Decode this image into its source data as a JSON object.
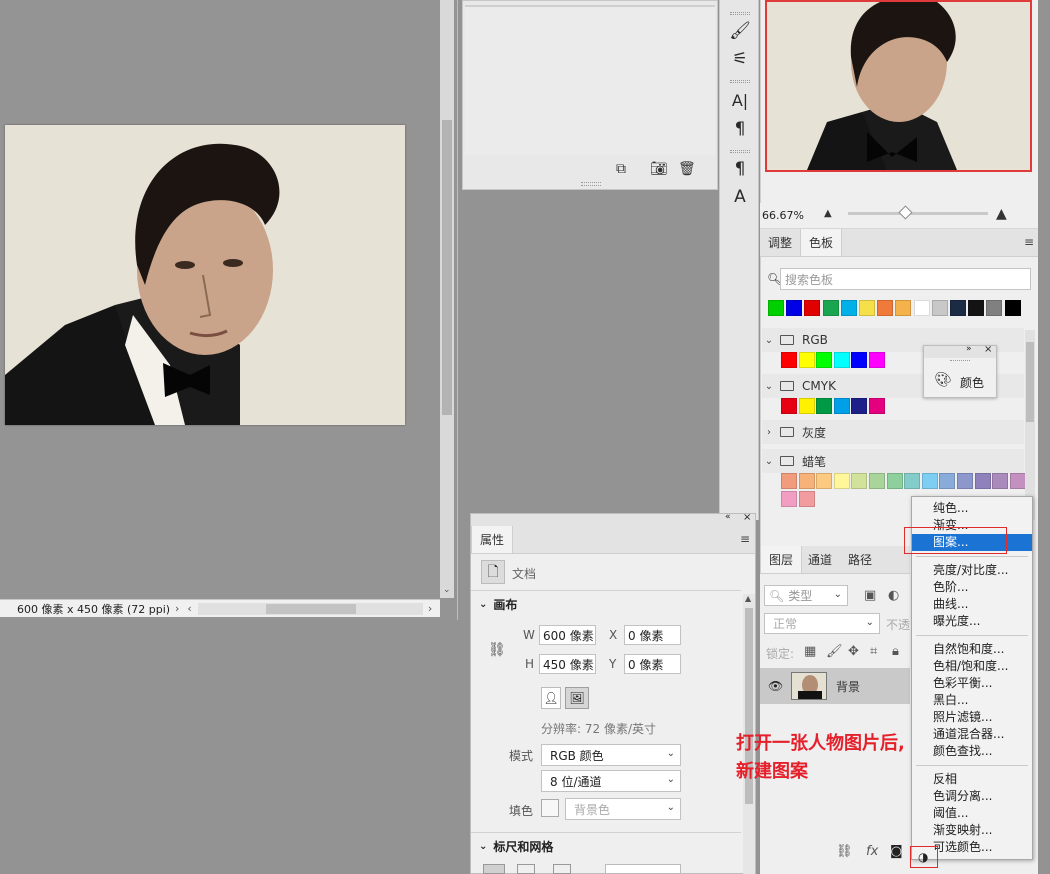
{
  "document": {
    "status_text": "600 像素 x 450 像素 (72 ppi)"
  },
  "navigator": {
    "zoom": "66.67%",
    "zoom_fraction": 0.4
  },
  "swatches_panel": {
    "tabs": [
      "调整",
      "色板"
    ],
    "active_tab": "色板",
    "search_placeholder": "搜索色板",
    "recent_colors": [
      "#00d000",
      "#0000e6",
      "#e00000",
      "#1aa650",
      "#00b0e6",
      "#f5e04a",
      "#f07a3a",
      "#f5b14a",
      "#ffffff",
      "#c8c8c8",
      "#1c2b44",
      "#141414",
      "#808080",
      "#000000"
    ],
    "groups": [
      {
        "name": "RGB",
        "expanded": true,
        "colors": [
          "#ff0000",
          "#ffff00",
          "#00ff00",
          "#00ffff",
          "#0000ff",
          "#ff00ff"
        ]
      },
      {
        "name": "CMYK",
        "expanded": true,
        "colors": [
          "#e60012",
          "#fff100",
          "#009944",
          "#00a0e9",
          "#1d2088",
          "#e4007f"
        ]
      },
      {
        "name": "灰度",
        "expanded": false,
        "colors": []
      },
      {
        "name": "蜡笔",
        "expanded": true,
        "colors": [
          "#f29c7e",
          "#f7b27a",
          "#fcc980",
          "#fff799",
          "#d1e29a",
          "#a9d49a",
          "#8ecf9e",
          "#84ccc9",
          "#7ecef4",
          "#88abda",
          "#8c97cb",
          "#8f82bc",
          "#aa89bd",
          "#c490bf",
          "#f19ec2",
          "#f29c9f"
        ]
      }
    ]
  },
  "mini_color_panel": {
    "label": "颜色"
  },
  "properties": {
    "title": "属性",
    "doc_label": "文档",
    "canvas_section": "画布",
    "w_label": "W",
    "w_value": "600 像素",
    "x_label": "X",
    "x_value": "0 像素",
    "h_label": "H",
    "h_value": "450 像素",
    "y_label": "Y",
    "y_value": "0 像素",
    "resolution": "分辨率: 72 像素/英寸",
    "mode_label": "模式",
    "mode_value": "RGB 颜色",
    "depth_value": "8 位/通道",
    "fill_label": "填色",
    "fill_value": "背景色",
    "rulers_section": "标尺和网格"
  },
  "layers": {
    "tabs": [
      "图层",
      "通道",
      "路径"
    ],
    "active_tab": "图层",
    "filter_label": "类型",
    "blend_mode": "正常",
    "opacity_label": "不透",
    "lock_label": "锁定:",
    "layer_name": "背景"
  },
  "context_menu": {
    "items": [
      "纯色...",
      "渐变...",
      "图案...",
      "亮度/对比度...",
      "色阶...",
      "曲线...",
      "曝光度...",
      "自然饱和度...",
      "色相/饱和度...",
      "色彩平衡...",
      "黑白...",
      "照片滤镜...",
      "通道混合器...",
      "颜色查找...",
      "反相",
      "色调分离...",
      "阈值...",
      "渐变映射...",
      "可选颜色..."
    ],
    "highlighted": "图案..."
  },
  "annotation": {
    "line1": "打开一张人物图片后,",
    "line2": "新建图案"
  },
  "colors": {
    "accent_red": "#e22a2a",
    "highlight_blue": "#1b74d4"
  }
}
